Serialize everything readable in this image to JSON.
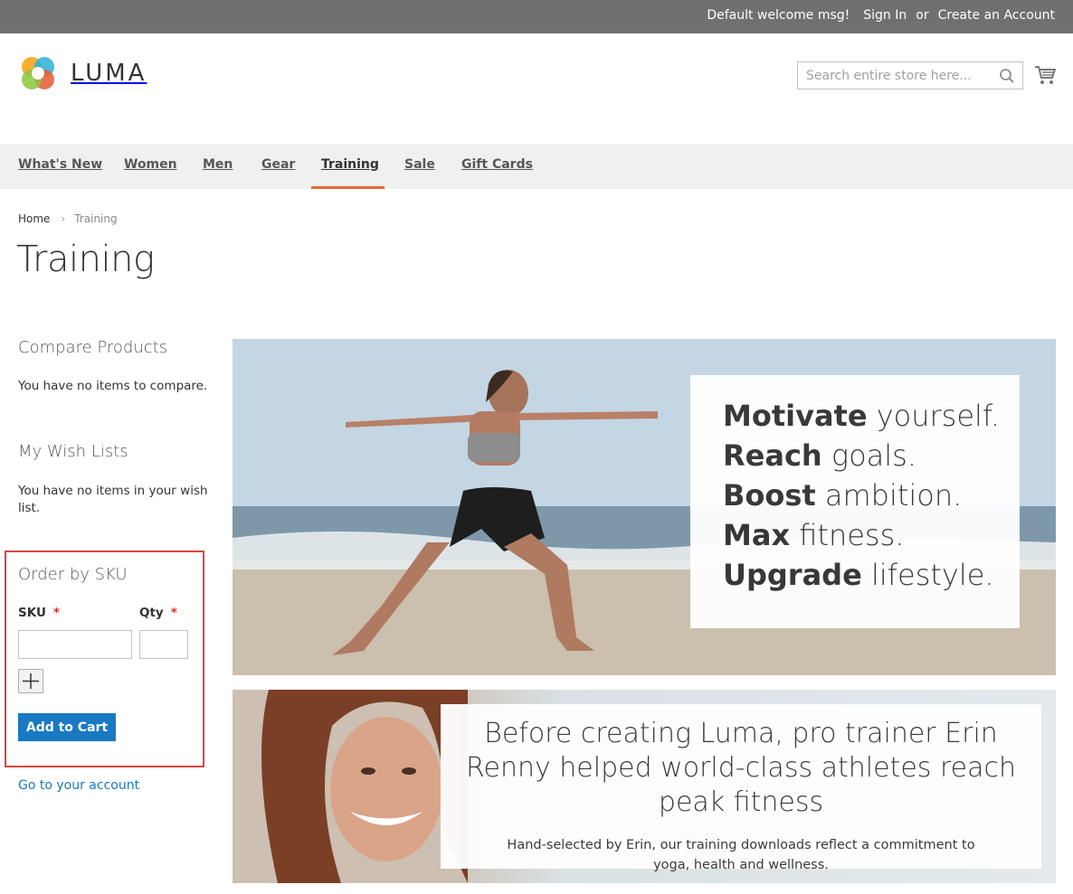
{
  "top_panel": {
    "welcome": "Default welcome msg!",
    "sign_in": "Sign In",
    "or": "or",
    "create_account": "Create an Account"
  },
  "header": {
    "logo_text": "LUMA",
    "search_placeholder": "Search entire store here...",
    "search_icon": "search-icon",
    "cart_icon": "cart-icon"
  },
  "nav": {
    "items": [
      {
        "label": "What's New"
      },
      {
        "label": "Women"
      },
      {
        "label": "Men"
      },
      {
        "label": "Gear"
      },
      {
        "label": "Training",
        "active": true
      },
      {
        "label": "Sale"
      },
      {
        "label": "Gift Cards"
      }
    ],
    "active_color": "#e56b33"
  },
  "breadcrumb": {
    "home": "Home",
    "current": "Training"
  },
  "page_title": "Training",
  "sidebar": {
    "compare_title": "Compare Products",
    "compare_text": "You have no items to compare.",
    "wishlist_title": "My Wish Lists",
    "wishlist_text": "You have no items in your wish list.",
    "sku": {
      "title": "Order by SKU",
      "sku_label": "SKU",
      "qty_label": "Qty",
      "required_mark": "*",
      "sku_value": "",
      "qty_value": "",
      "add_row_icon": "plus-icon",
      "add_to_cart": "Add to Cart"
    },
    "account_link": "Go to your account"
  },
  "hero1": {
    "lines": [
      {
        "bold": "Motivate",
        "rest": " yourself."
      },
      {
        "bold": "Reach",
        "rest": " goals."
      },
      {
        "bold": "Boost",
        "rest": " ambition."
      },
      {
        "bold": "Max",
        "rest": " fitness."
      },
      {
        "bold": "Upgrade",
        "rest": " lifestyle."
      }
    ]
  },
  "hero2": {
    "headline": "Before creating Luma, pro trainer Erin Renny helped world-class athletes reach peak fitness",
    "sub": "Hand-selected by Erin, our training downloads reflect a commitment to yoga, health and wellness."
  },
  "colors": {
    "top_panel": "#6e716e",
    "primary_button": "#1979c3",
    "link": "#1979c3",
    "required": "#e02b27",
    "highlight_border": "#d9463f"
  }
}
